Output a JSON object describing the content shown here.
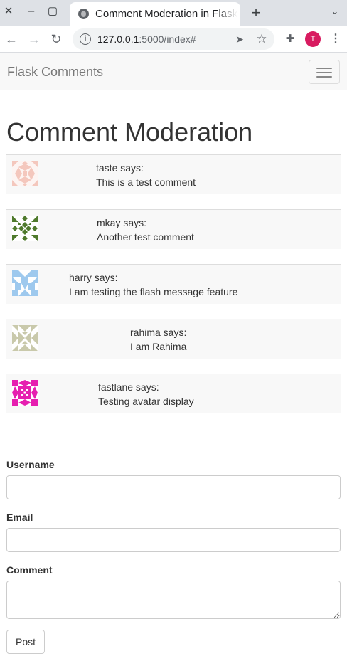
{
  "browser": {
    "tab_title": "Comment Moderation in Flask",
    "url_host": "127.0.0.1",
    "url_rest": ":5000/index#",
    "profile_initial": "T",
    "profile_color": "#d81b60"
  },
  "navbar": {
    "brand": "Flask Comments"
  },
  "page": {
    "title": "Comment Moderation"
  },
  "comments": [
    {
      "author_line": "taste says:",
      "text": "This is a test comment",
      "avatar_color": "#f4c7bd"
    },
    {
      "author_line": "mkay says:",
      "text": "Another test comment",
      "avatar_color": "#4f7a2c"
    },
    {
      "author_line": "harry says:",
      "text": "I am testing the flash message feature",
      "avatar_color": "#9ec9ee"
    },
    {
      "author_line": "rahima says:",
      "text": "I am Rahima",
      "avatar_color": "#c9c9ab"
    },
    {
      "author_line": "fastlane says:",
      "text": "Testing avatar display",
      "avatar_color": "#e61fb0"
    }
  ],
  "form": {
    "username_label": "Username",
    "username_value": "",
    "email_label": "Email",
    "email_value": "",
    "comment_label": "Comment",
    "comment_value": "",
    "submit_label": "Post"
  }
}
